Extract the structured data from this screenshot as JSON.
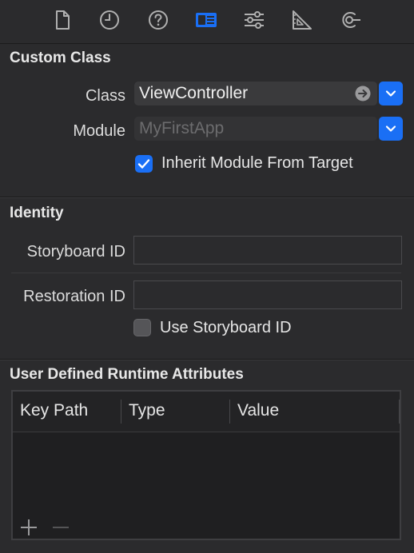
{
  "toolbar": {
    "tabs": [
      {
        "icon": "file-icon",
        "active": false
      },
      {
        "icon": "clock-icon",
        "active": false
      },
      {
        "icon": "help-icon",
        "active": false
      },
      {
        "icon": "identity-inspector-icon",
        "active": true
      },
      {
        "icon": "sliders-icon",
        "active": false
      },
      {
        "icon": "ruler-icon",
        "active": false
      },
      {
        "icon": "connections-icon",
        "active": false
      }
    ],
    "accent_color": "#1a6ff5",
    "icon_color": "#b0b0b0"
  },
  "custom_class": {
    "title": "Custom Class",
    "class_label": "Class",
    "class_value": "ViewController",
    "module_label": "Module",
    "module_placeholder": "MyFirstApp",
    "inherit_label": "Inherit Module From Target",
    "inherit_checked": true
  },
  "identity": {
    "title": "Identity",
    "storyboard_id_label": "Storyboard ID",
    "storyboard_id_value": "",
    "restoration_id_label": "Restoration ID",
    "restoration_id_value": "",
    "use_storyboard_id_label": "Use Storyboard ID",
    "use_storyboard_id_checked": false
  },
  "runtime_attributes": {
    "title": "User Defined Runtime Attributes",
    "columns": [
      "Key Path",
      "Type",
      "Value"
    ],
    "rows": []
  }
}
